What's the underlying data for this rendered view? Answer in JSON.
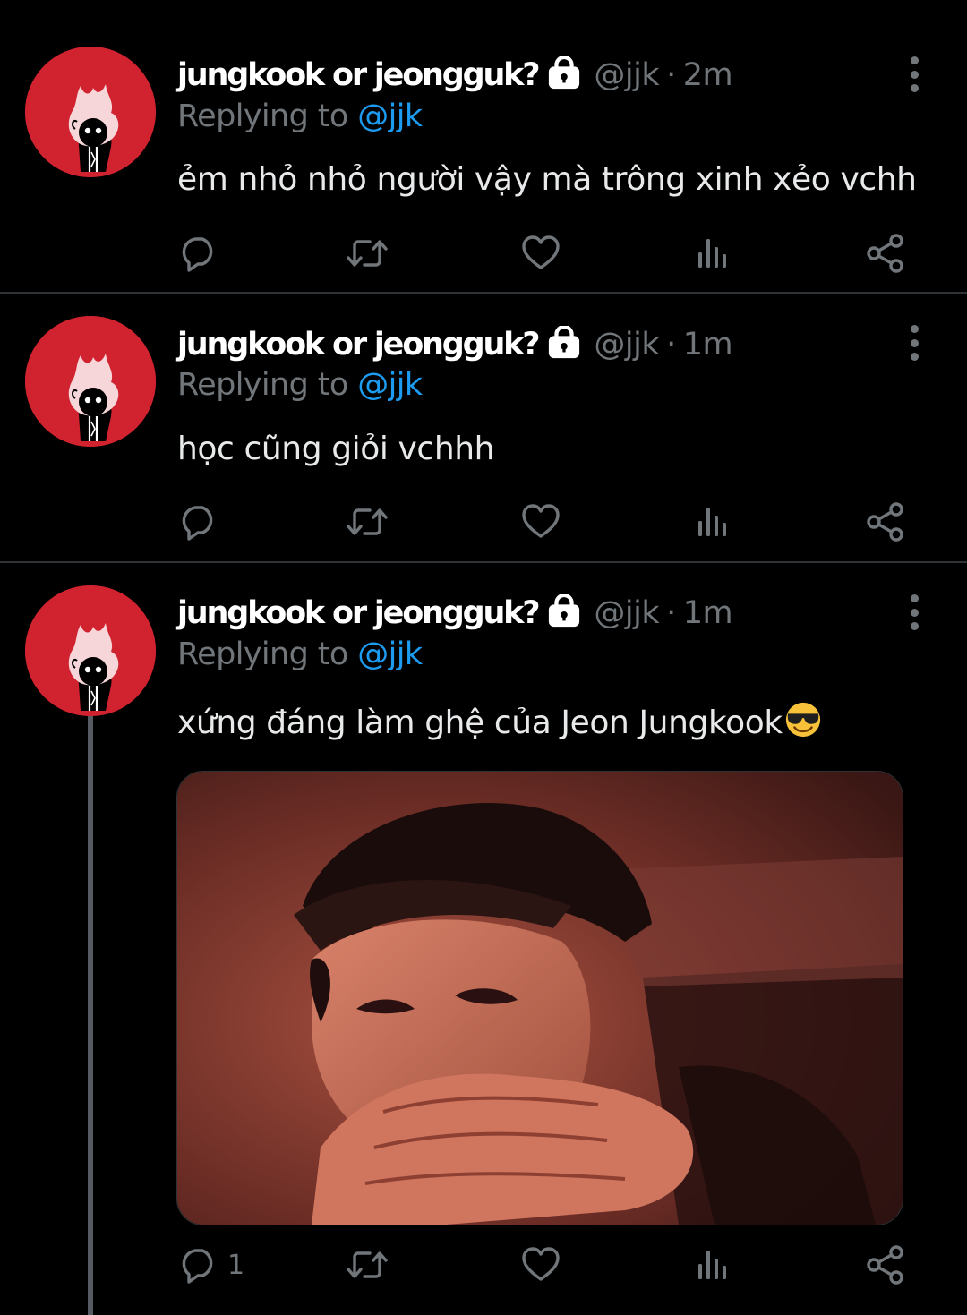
{
  "tweets": [
    {
      "author_name": "jungkook or jeongguk?",
      "handle": "@jjk",
      "separator": "·",
      "time": "2m",
      "replying_prefix": "Replying to ",
      "replying_to": "@jjk",
      "text": "ẻm nhỏ nhỏ người vậy mà trông xinh xẻo vchh",
      "reply_count": ""
    },
    {
      "author_name": "jungkook or jeongguk?",
      "handle": "@jjk",
      "separator": "·",
      "time": "1m",
      "replying_prefix": "Replying to ",
      "replying_to": "@jjk",
      "text": "học cũng giỏi vchhh",
      "reply_count": ""
    },
    {
      "author_name": "jungkook or jeongguk?",
      "handle": "@jjk",
      "separator": "·",
      "time": "1m",
      "replying_prefix": "Replying to ",
      "replying_to": "@jjk",
      "text": "xứng đáng làm ghệ của Jeon Jungkook",
      "emoji": "smiling-face-with-sunglasses",
      "has_media": true,
      "reply_count": "1"
    }
  ],
  "icons": {
    "reply": "reply-icon",
    "retweet": "retweet-icon",
    "like": "heart-icon",
    "views": "views-chart-icon",
    "share": "share-icon",
    "lock": "lock-icon",
    "more": "more-options-icon"
  },
  "colors": {
    "background": "#000000",
    "avatar": "#d0232f",
    "mention": "#1d9bf0",
    "muted": "#71767b",
    "divider": "#2f3336"
  }
}
